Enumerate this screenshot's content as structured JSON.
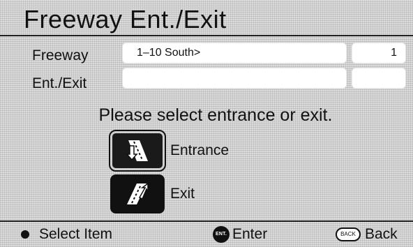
{
  "title": "Freeway Ent./Exit",
  "rows": [
    {
      "label": "Freeway",
      "value": "1–10 South>",
      "count": "1"
    },
    {
      "label": "Ent./Exit",
      "value": "",
      "count": ""
    }
  ],
  "prompt": "Please select entrance or exit.",
  "options": {
    "entrance": {
      "label": "Entrance",
      "icon": "freeway-entrance-icon"
    },
    "exit": {
      "label": "Exit",
      "icon": "freeway-exit-icon"
    }
  },
  "footer": {
    "select_label": "Select Item",
    "enter_label": "Enter",
    "enter_icon_text": "ENT.",
    "back_label": "Back",
    "back_icon_text": "BACK"
  }
}
